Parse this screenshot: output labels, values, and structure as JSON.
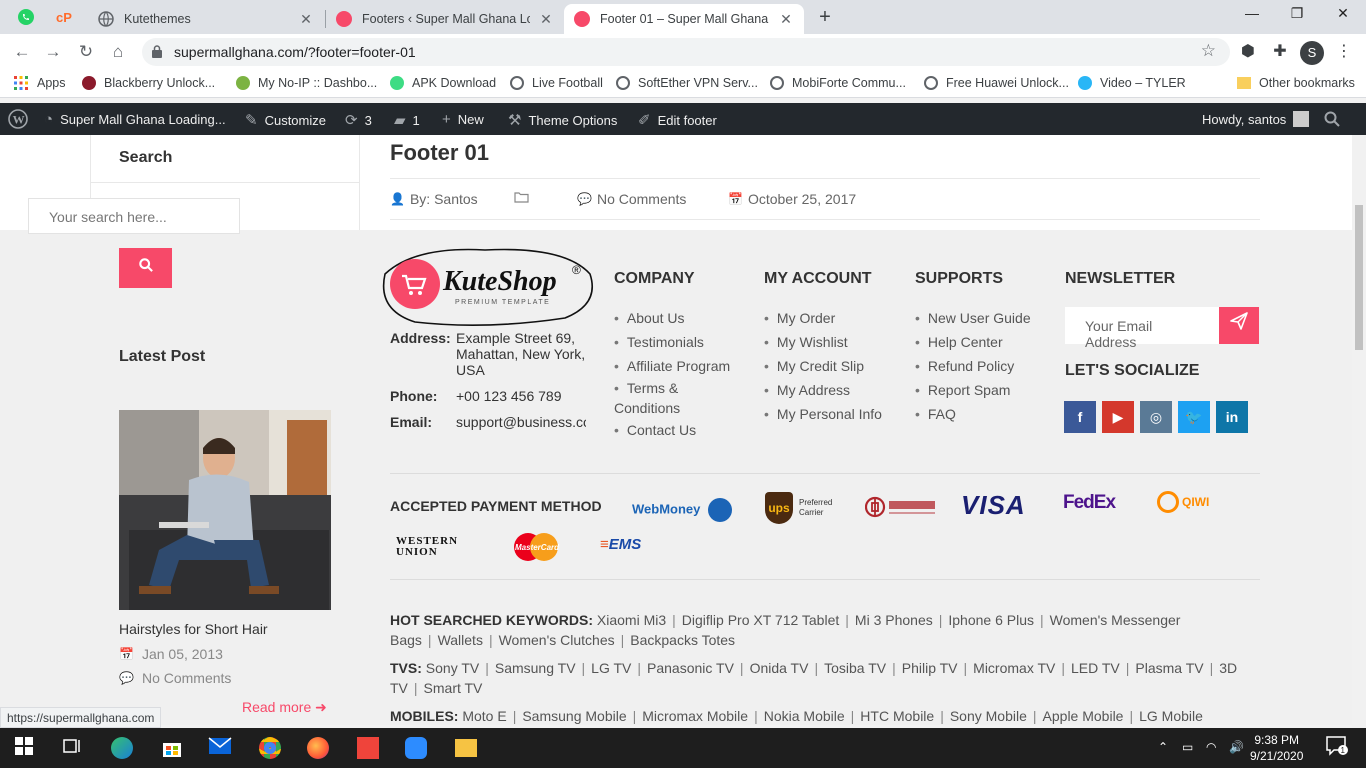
{
  "browser": {
    "tabs": [
      {
        "title": "Kutethemes",
        "active": false
      },
      {
        "title": "Footers ‹ Super Mall Ghana Loadi",
        "active": false
      },
      {
        "title": "Footer 01 – Super Mall Ghana Lo",
        "active": true
      }
    ],
    "url": "supermallghana.com/?footer=footer-01",
    "profile_initial": "S",
    "status_url": "https://supermallghana.com",
    "bookmarks": [
      "Apps",
      "Blackberry Unlock...",
      "My No-IP :: Dashbo...",
      "APK Download",
      "Live Football",
      "SoftEther VPN Serv...",
      "MobiForte Commu...",
      "Free Huawei Unlock...",
      "Video – TYLER",
      "Other bookmarks"
    ]
  },
  "adminbar": {
    "site": "Super Mall Ghana Loading...",
    "customize": "Customize",
    "updates": "3",
    "comments": "1",
    "new": "New",
    "theme_options": "Theme Options",
    "edit_footer": "Edit footer",
    "howdy": "Howdy, santos"
  },
  "sidebar": {
    "search_title": "Search",
    "search_placeholder": "Your search here...",
    "latest_title": "Latest Post",
    "post": {
      "title": "Hairstyles for Short Hair",
      "date": "Jan 05, 2013",
      "comments": "No Comments",
      "read_more": "Read more"
    }
  },
  "post": {
    "title": "Footer 01",
    "author": "By: Santos",
    "comments": "No Comments",
    "date": "October 25, 2017"
  },
  "footer": {
    "logo_text": "KuteShop",
    "logo_sub": "PREMIUM TEMPLATE",
    "contact": {
      "address_label": "Address:",
      "address": "Example Street 69, Mahattan, New York, USA",
      "phone_label": "Phone:",
      "phone": "+00 123 456 789",
      "email_label": "Email:",
      "email": "support@business.com"
    },
    "company": {
      "title": "COMPANY",
      "items": [
        "About Us",
        "Testimonials",
        "Affiliate Program",
        "Terms & Conditions",
        "Contact Us"
      ]
    },
    "account": {
      "title": "MY ACCOUNT",
      "items": [
        "My Order",
        "My Wishlist",
        "My Credit Slip",
        "My Address",
        "My Personal Info"
      ]
    },
    "supports": {
      "title": "SUPPORTS",
      "items": [
        "New User Guide",
        "Help Center",
        "Refund Policy",
        "Report Spam",
        "FAQ"
      ]
    },
    "newsletter": {
      "title": "NEWSLETTER",
      "placeholder": "Your Email Address",
      "social_title": "LET'S SOCIALIZE"
    },
    "payment_title": "ACCEPTED PAYMENT METHOD",
    "payments": [
      "WebMoney",
      "ups",
      "Preferred Carrier",
      "VISA",
      "FedEx",
      "QIWI",
      "WESTERN UNION",
      "MasterCard",
      "EMS"
    ],
    "keywords": [
      {
        "label": "HOT SEARCHED KEYWORDS:",
        "items": [
          "Xiaomi Mi3",
          "Digiflip Pro XT 712 Tablet",
          "Mi 3 Phones",
          "Iphone 6 Plus",
          "Women's Messenger Bags",
          "Wallets",
          "Women's Clutches",
          "Backpacks Totes"
        ]
      },
      {
        "label": "TVS:",
        "items": [
          "Sony TV",
          "Samsung TV",
          "LG TV",
          "Panasonic TV",
          "Onida TV",
          "Tosiba TV",
          "Philip TV",
          "Micromax TV",
          "LED TV",
          "Plasma TV",
          "3D TV",
          "Smart TV"
        ]
      },
      {
        "label": "MOBILES:",
        "items": [
          "Moto E",
          "Samsung Mobile",
          "Micromax Mobile",
          "Nokia Mobile",
          "HTC Mobile",
          "Sony Mobile",
          "Apple Mobile",
          "LG Mobile"
        ]
      }
    ]
  },
  "taskbar": {
    "time": "9:38 PM",
    "date": "9/21/2020",
    "notifications": "1"
  },
  "colors": {
    "accent": "#f74969",
    "facebook": "#3b5998",
    "youtube": "#d4382c",
    "instagram": "#5a7a96",
    "twitter": "#1da1f2",
    "linkedin": "#0e76a8"
  }
}
